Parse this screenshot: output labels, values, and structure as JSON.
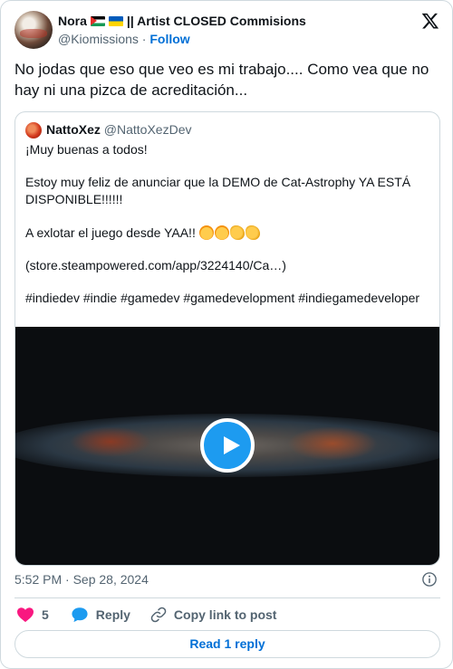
{
  "author": {
    "name": "Nora",
    "name_suffix": "|| Artist CLOSED Commisions",
    "handle": "@Kiomissions",
    "separator": "·",
    "follow_label": "Follow"
  },
  "tweet_text": "No jodas que eso que veo es mi trabajo.... Como vea que no hay ni una pizca de acreditación...",
  "quote": {
    "name": "NattoXez",
    "handle": "@NattoXezDev",
    "line1": "¡Muy buenas a todos!",
    "line2": "Estoy muy feliz de anunciar que la DEMO de Cat-Astrophy YA ESTÁ DISPONIBLE!!!!!!",
    "line3": "A exlotar el juego desde YAA!!",
    "line3_emojis": [
      "party-face-icon",
      "party-face-icon",
      "flexed-bicep-icon",
      "flexed-bicep-icon"
    ],
    "link": "(store.steampowered.com/app/3224140/Ca…)",
    "hashtags": "#indiedev #indie #gamedev #gamedevelopment #indiegamedeveloper"
  },
  "timestamp": "5:52 PM · Sep 28, 2024",
  "actions": {
    "like_count": "5",
    "reply_label": "Reply",
    "copy_label": "Copy link to post"
  },
  "read_replies_label": "Read 1 reply",
  "colors": {
    "accent": "#1d9bf0",
    "link": "#006fd6",
    "like": "#f91880",
    "muted": "#536471",
    "border": "#cfd9de"
  }
}
